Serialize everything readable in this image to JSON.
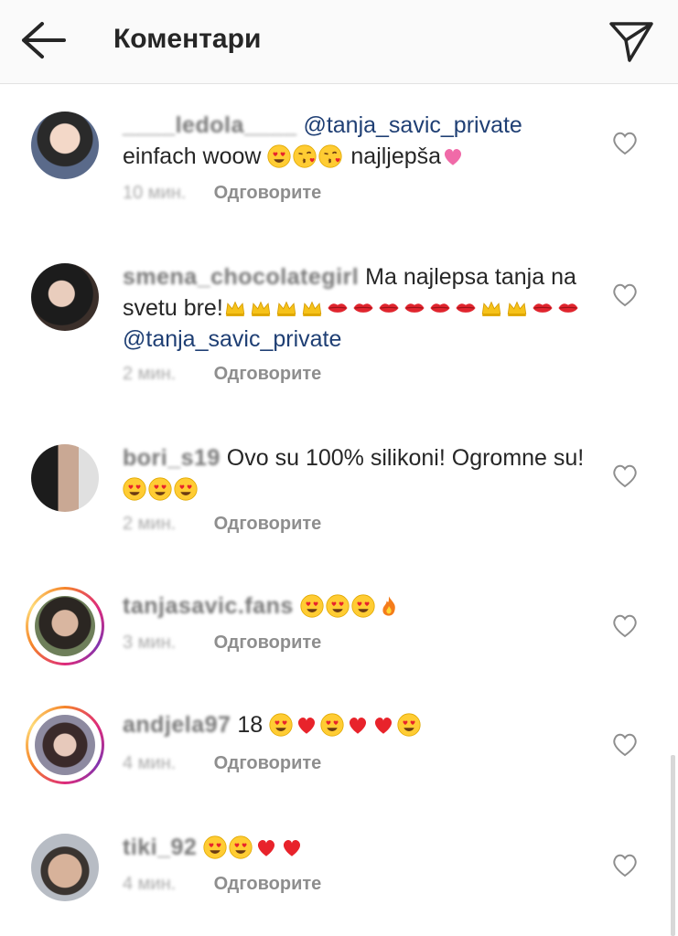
{
  "header": {
    "title": "Коментари",
    "back_icon": "arrow-left-icon",
    "send_icon": "paper-plane-icon"
  },
  "reply_label": "Одговорите",
  "comments": [
    {
      "username": "____ledola____",
      "text_before": "",
      "mention": "@tanja_savic_private",
      "text_line2": "einfach woow",
      "text_after": "najljepša",
      "time": "10 мин.",
      "emojis": [
        "heart-eyes",
        "kiss",
        "kiss",
        "pink-heart"
      ],
      "story_ring": false
    },
    {
      "username": "smena_chocolategirl",
      "text": "Ma najlepsa tanja na svetu bre!",
      "mention": "@tanja_savic_private",
      "time": "2 мин.",
      "emojis": [
        "crown",
        "crown",
        "crown",
        "crown",
        "lips",
        "lips",
        "lips",
        "lips",
        "lips",
        "lips",
        "crown",
        "crown",
        "lips",
        "lips"
      ],
      "story_ring": false
    },
    {
      "username": "bori_s19",
      "text": "Ovo su 100% silikoni! Ogromne su!",
      "time": "2 мин.",
      "emojis": [
        "heart-eyes",
        "heart-eyes",
        "heart-eyes"
      ],
      "story_ring": false
    },
    {
      "username": "tanjasavic.fans",
      "text": "",
      "time": "3 мин.",
      "emojis": [
        "heart-eyes",
        "heart-eyes",
        "heart-eyes",
        "fire"
      ],
      "story_ring": true
    },
    {
      "username": "andjela97",
      "text": "18",
      "time": "4 мин.",
      "emojis": [
        "heart-eyes",
        "red-heart",
        "heart-eyes",
        "red-heart",
        "red-heart",
        "heart-eyes"
      ],
      "story_ring": true
    },
    {
      "username": "tiki_92",
      "text": "",
      "time": "4 мин.",
      "emojis": [
        "heart-eyes",
        "heart-eyes",
        "red-heart",
        "red-heart"
      ],
      "story_ring": false
    }
  ],
  "colors": {
    "header_bg": "#fafafa",
    "mention": "#1f3f74",
    "meta": "#8e8e8e",
    "text": "#262626"
  }
}
